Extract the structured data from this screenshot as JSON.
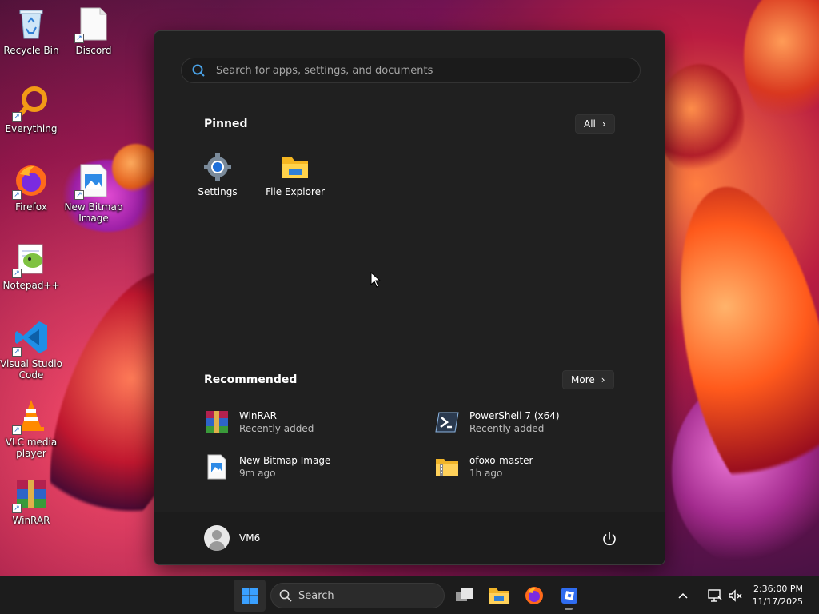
{
  "desktop": {
    "icons": [
      {
        "label": "Recycle Bin",
        "icon": "recycle-bin-icon"
      },
      {
        "label": "Discord",
        "icon": "file-shortcut-icon"
      },
      {
        "label": "Everything",
        "icon": "everything-icon"
      },
      {
        "label": "Firefox",
        "icon": "firefox-icon"
      },
      {
        "label": "New Bitmap Image",
        "icon": "bitmap-image-icon"
      },
      {
        "label": "Notepad++",
        "icon": "notepad-plus-plus-icon"
      },
      {
        "label": "Visual Studio Code",
        "icon": "vscode-icon"
      },
      {
        "label": "VLC media player",
        "icon": "vlc-icon"
      },
      {
        "label": "WinRAR",
        "icon": "winrar-icon"
      }
    ]
  },
  "start_menu": {
    "search_placeholder": "Search for apps, settings, and documents",
    "pinned_title": "Pinned",
    "all_button": "All",
    "pinned": [
      {
        "label": "Settings",
        "icon": "settings-gear-icon"
      },
      {
        "label": "File Explorer",
        "icon": "folder-icon"
      }
    ],
    "recommended_title": "Recommended",
    "more_button": "More",
    "recommended": [
      {
        "name": "WinRAR",
        "sub": "Recently added",
        "icon": "winrar-icon"
      },
      {
        "name": "PowerShell 7 (x64)",
        "sub": "Recently added",
        "icon": "powershell-icon"
      },
      {
        "name": "New Bitmap Image",
        "sub": "9m ago",
        "icon": "bitmap-image-icon"
      },
      {
        "name": "ofoxo-master",
        "sub": "1h ago",
        "icon": "zip-folder-icon"
      }
    ],
    "user_name": "VM6"
  },
  "taskbar": {
    "search_label": "Search",
    "time": "2:36:00 PM",
    "date": "11/17/2025",
    "apps": [
      "task-view-icon",
      "file-explorer-icon",
      "firefox-icon",
      "roblox-icon"
    ]
  },
  "colors": {
    "accent": "#0078d4",
    "start_bg": "#202020",
    "taskbar_bg": "#1c1c1c"
  }
}
